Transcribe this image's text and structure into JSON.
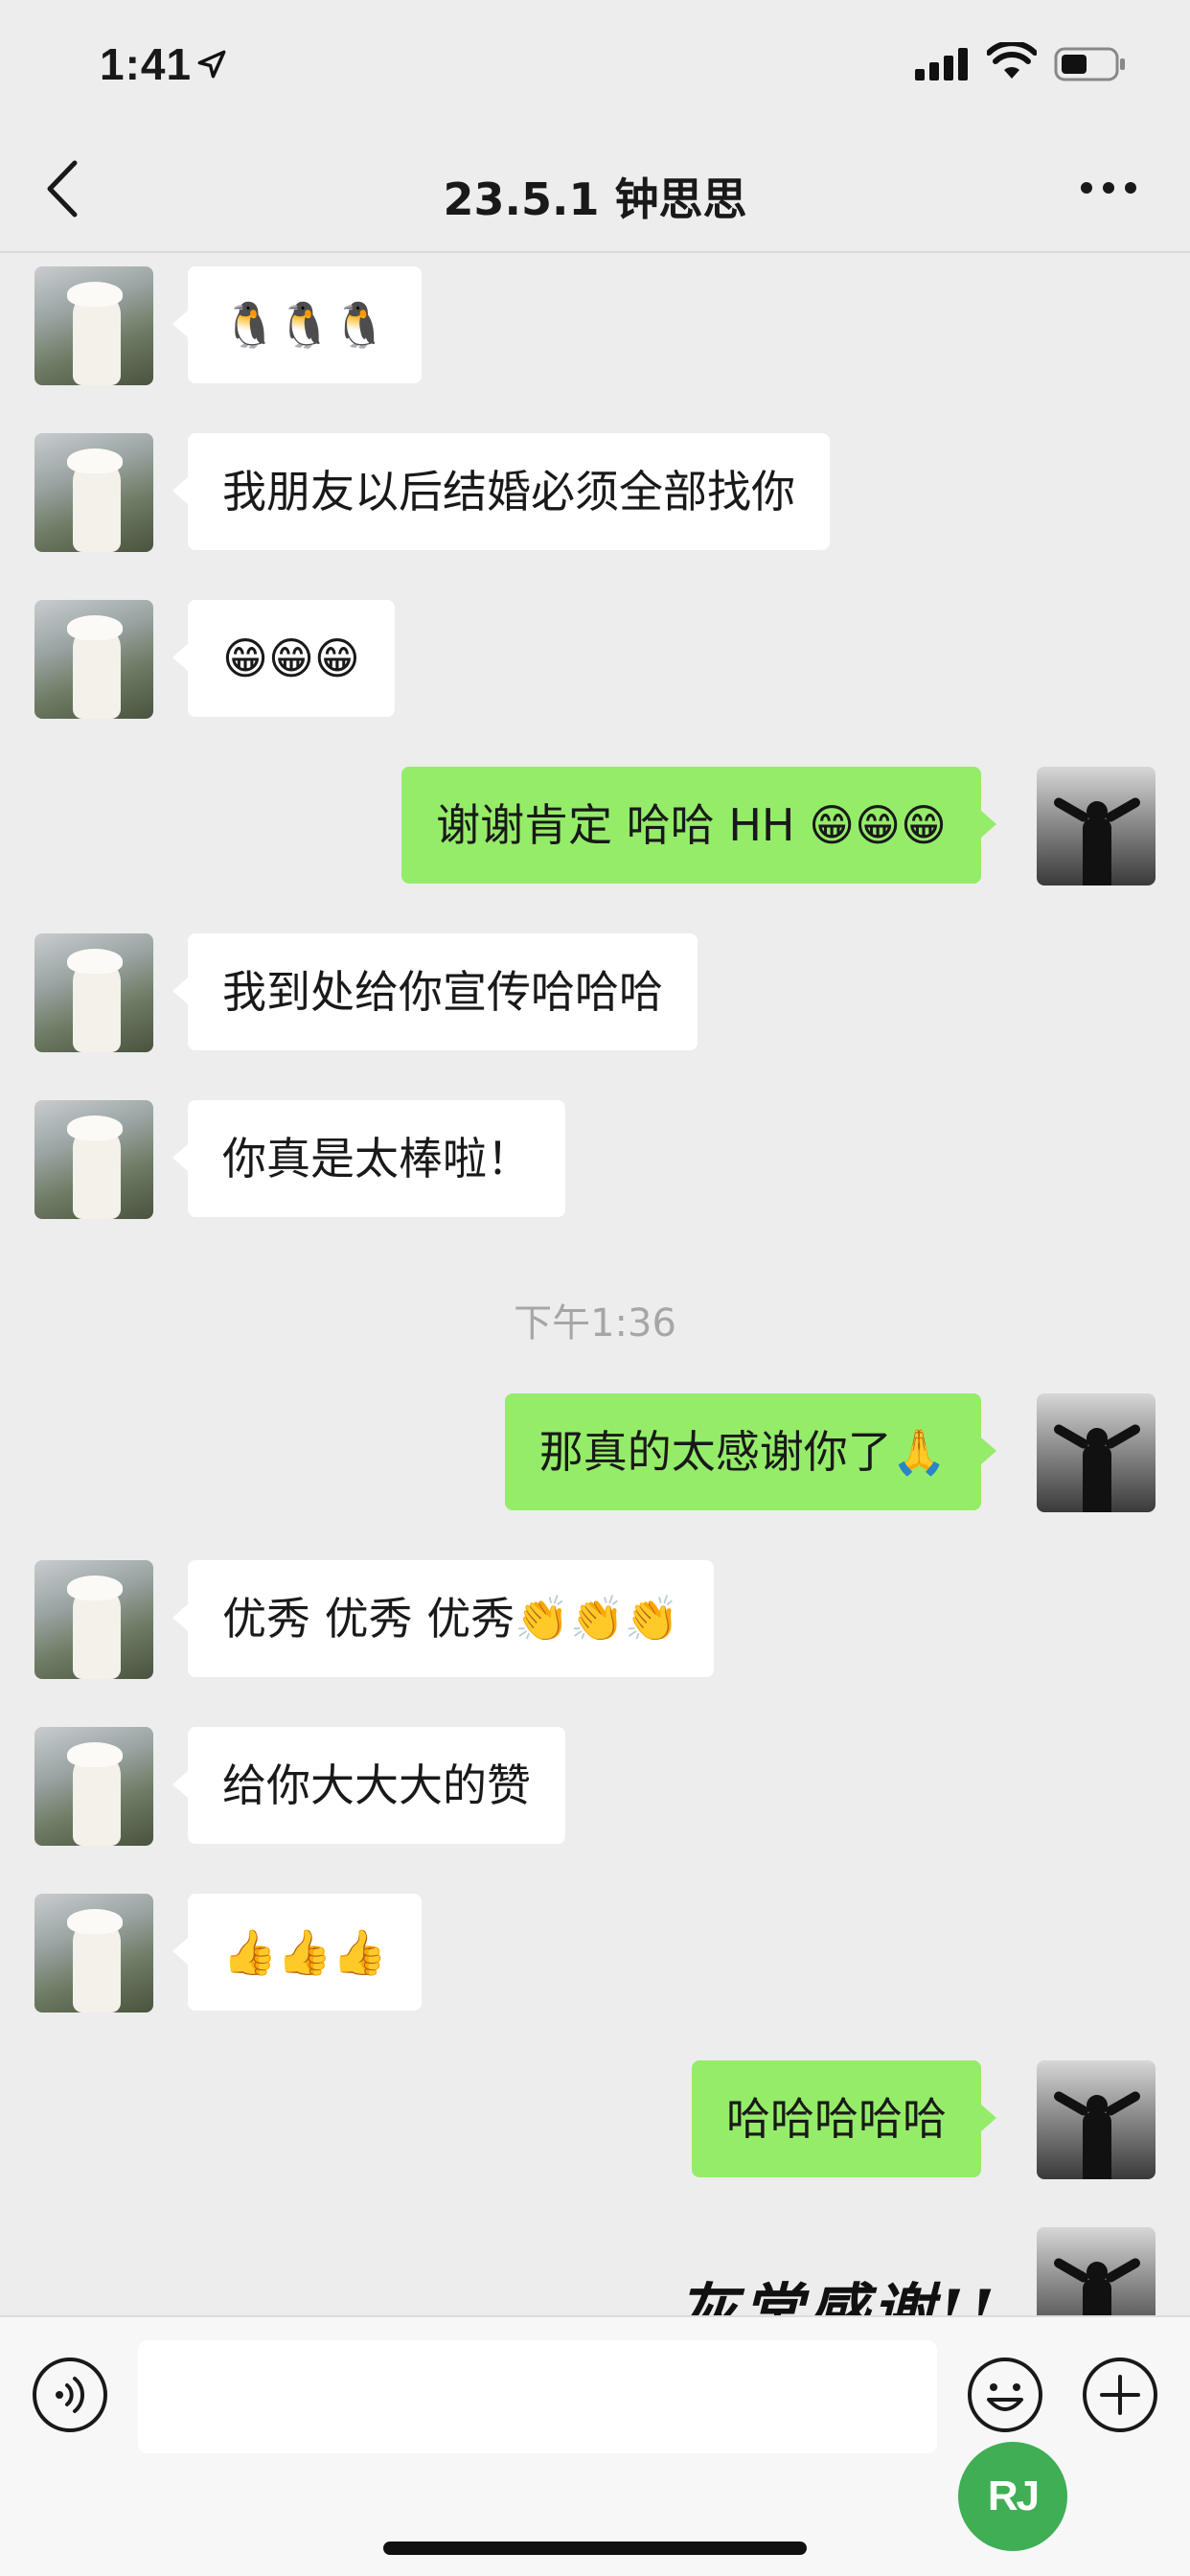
{
  "status_bar": {
    "time": "1:41"
  },
  "nav": {
    "title": "23.5.1 钟思思"
  },
  "messages": [
    {
      "side": "left",
      "text": "🐧🐧🐧"
    },
    {
      "side": "left",
      "text": "我朋友以后结婚必须全部找你"
    },
    {
      "side": "left",
      "text": "😁😁😁"
    },
    {
      "side": "right",
      "text": "谢谢肯定 哈哈 HH 😁😁😁"
    },
    {
      "side": "left",
      "text": "我到处给你宣传哈哈哈"
    },
    {
      "side": "left",
      "text": "你真是太棒啦！"
    },
    {
      "side": "right",
      "text": "那真的太感谢你了🙏"
    },
    {
      "side": "left",
      "text": "优秀 优秀 优秀👏👏👏"
    },
    {
      "side": "left",
      "text": "给你大大大的赞"
    },
    {
      "side": "left",
      "text": "👍👍👍"
    },
    {
      "side": "right",
      "text": "哈哈哈哈哈"
    }
  ],
  "timestamp": "下午1:36",
  "sticker": {
    "text": "灰常感谢!!"
  },
  "watermark": {
    "text": "RJ"
  },
  "icons": {
    "back": "chevron-left-icon",
    "more": "more-dots-icon",
    "voice": "voice-icon",
    "emoji": "emoji-icon",
    "plus": "plus-icon"
  },
  "colors": {
    "background": "#ededed",
    "bubble_self": "#95ec69",
    "bubble_other": "#ffffff",
    "timestamp": "#a6a6a6"
  }
}
